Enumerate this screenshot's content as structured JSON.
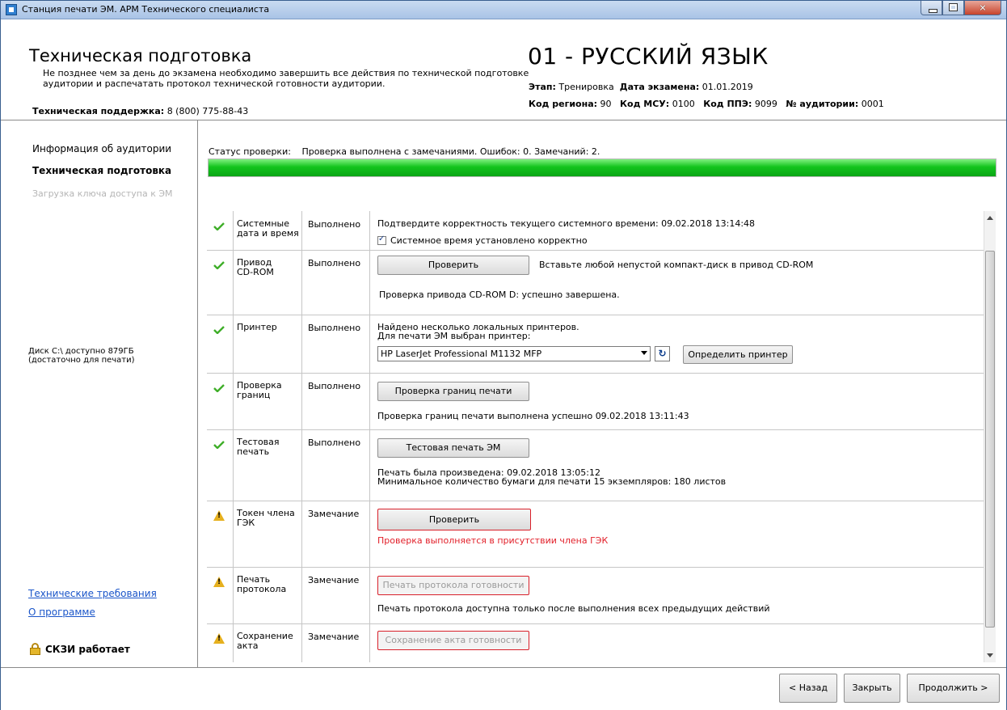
{
  "window": {
    "title": "Станция печати ЭМ. АРМ Технического специалиста"
  },
  "header": {
    "title": "Техническая подготовка",
    "description": "Не позднее чем за день до экзамена необходимо завершить все действия по технической подготовке аудитории и распечатать протокол технической готовности аудитории.",
    "support_label": "Техническая поддержка:",
    "support_phone": "8 (800) 775-88-43",
    "subject": "01 - РУССКИЙ ЯЗЫК",
    "stage_label": "Этап:",
    "stage_value": "Тренировка",
    "exam_date_label": "Дата экзамена:",
    "exam_date_value": "01.01.2019",
    "region_label": "Код региона:",
    "region_value": "90",
    "msu_label": "Код МСУ:",
    "msu_value": "0100",
    "ppe_label": "Код ППЭ:",
    "ppe_value": "9099",
    "room_label": "№ аудитории:",
    "room_value": "0001"
  },
  "sidebar": {
    "items": [
      {
        "label": "Информация об аудитории",
        "state": "normal"
      },
      {
        "label": "Техническая подготовка",
        "state": "active"
      },
      {
        "label": "Загрузка ключа доступа к ЭМ",
        "state": "disabled"
      }
    ],
    "disk_line1": "Диск C:\\ доступно 879ГБ",
    "disk_line2": "(достаточно для печати)",
    "link_tech": "Технические требования",
    "link_about": "О программе",
    "skzi": "СКЗИ работает"
  },
  "main": {
    "status_label": "Статус проверки:",
    "status_text": "Проверка выполнена с замечаниями. Ошибок: 0. Замечаний: 2.",
    "progress": 1.0,
    "rows": {
      "sysdate": {
        "name_line1": "Системные",
        "name_line2": "дата и время",
        "status": "Выполнено",
        "text1": "Подтвердите корректность текущего системного времени: 09.02.2018 13:14:48",
        "checkbox_label": "Системное время установлено корректно"
      },
      "cdrom": {
        "name_line1": "Привод",
        "name_line2": "CD-ROM",
        "status": "Выполнено",
        "button": "Проверить",
        "hint": "Вставьте любой непустой компакт-диск в привод CD-ROM",
        "result": "Проверка привода CD-ROM D: успешно завершена."
      },
      "printer": {
        "name_line1": "Принтер",
        "status": "Выполнено",
        "text1": "Найдено несколько локальных принтеров.",
        "text2": "Для печати ЭМ выбран принтер:",
        "selected": "HP LaserJet Professional M1132 MFP",
        "button": "Определить принтер"
      },
      "bounds": {
        "name_line1": "Проверка",
        "name_line2": "границ",
        "status": "Выполнено",
        "button": "Проверка границ печати",
        "result": "Проверка границ печати выполнена успешно 09.02.2018 13:11:43"
      },
      "testprint": {
        "name_line1": "Тестовая",
        "name_line2": "печать",
        "status": "Выполнено",
        "button": "Тестовая печать ЭМ",
        "result1": "Печать была произведена: 09.02.2018 13:05:12",
        "result2": "Минимальное количество бумаги для печати 15 экземпляров: 180 листов"
      },
      "token": {
        "name_line1": "Токен члена",
        "name_line2": "ГЭК",
        "status": "Замечание",
        "button": "Проверить",
        "note": "Проверка выполняется в присутствии члена ГЭК"
      },
      "protocol": {
        "name_line1": "Печать",
        "name_line2": "протокола",
        "status": "Замечание",
        "button": "Печать протокола готовности",
        "note": "Печать протокола доступна только после выполнения всех предыдущих действий"
      },
      "act": {
        "name_line1": "Сохранение",
        "name_line2": "акта",
        "status": "Замечание",
        "button": "Сохранение акта готовности"
      }
    }
  },
  "footer": {
    "back": "< Назад",
    "close": "Закрыть",
    "next": "Продолжить >"
  },
  "colors": {
    "ok_check": "#3fae29",
    "warning": "#e6b01e",
    "error_text": "#e2202a",
    "progress_fill": "#12c41c",
    "link": "#1a55c9"
  }
}
